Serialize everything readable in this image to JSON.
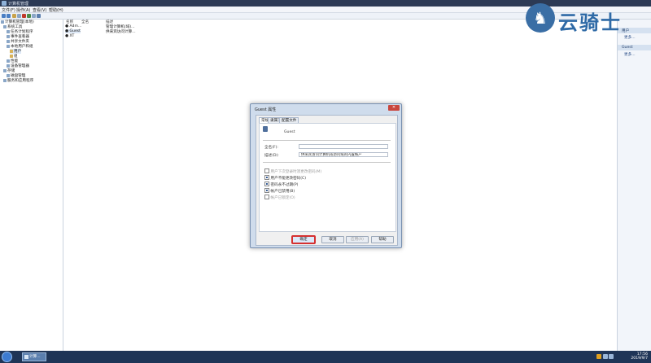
{
  "window": {
    "title": "计算机管理"
  },
  "menu": [
    "文件(F)",
    "操作(A)",
    "查看(V)",
    "帮助(H)"
  ],
  "tree": [
    {
      "label": "计算机管理(本地)",
      "level": 0
    },
    {
      "label": "系统工具",
      "level": 1
    },
    {
      "label": "任务计划程序",
      "level": 2
    },
    {
      "label": "事件查看器",
      "level": 2
    },
    {
      "label": "共享文件夹",
      "level": 2
    },
    {
      "label": "本地用户和组",
      "level": 2
    },
    {
      "label": "用户",
      "level": 3
    },
    {
      "label": "组",
      "level": 3
    },
    {
      "label": "性能",
      "level": 2
    },
    {
      "label": "设备管理器",
      "level": 2
    },
    {
      "label": "存储",
      "level": 1
    },
    {
      "label": "磁盘管理",
      "level": 2
    },
    {
      "label": "服务和应用程序",
      "level": 1
    }
  ],
  "list": {
    "columns": [
      "名称",
      "全名",
      "描述"
    ],
    "rows": [
      {
        "name": "Adm...",
        "fullname": "",
        "desc": "管理计算机(域)..."
      },
      {
        "name": "Guest",
        "fullname": "",
        "desc": "供来宾访问计算..."
      },
      {
        "name": "XT",
        "fullname": "",
        "desc": ""
      }
    ]
  },
  "actions": {
    "section1": "用户",
    "link1": "更多...",
    "section2": "Guest",
    "link2": "更多..."
  },
  "watermark": {
    "text": "云骑士"
  },
  "dialog": {
    "title": "Guest 属性",
    "tabs": [
      "常规",
      "隶属于",
      "配置文件"
    ],
    "username": "Guest",
    "fullname_label": "全名(F):",
    "fullname_value": "",
    "desc_label": "描述(D):",
    "desc_value": "供来宾访问计算机或访问域的内置帐户",
    "checkboxes": [
      {
        "label": "用户下次登录时须更改密码(M)",
        "checked": false,
        "disabled": true
      },
      {
        "label": "用户不能更改密码(C)",
        "checked": true,
        "disabled": false
      },
      {
        "label": "密码永不过期(P)",
        "checked": true,
        "disabled": false
      },
      {
        "label": "帐户已禁用(B)",
        "checked": true,
        "disabled": false
      },
      {
        "label": "帐户已锁定(O)",
        "checked": false,
        "disabled": true
      }
    ],
    "buttons": {
      "ok": "确定",
      "cancel": "取消",
      "apply": "应用(A)",
      "help": "帮助"
    }
  },
  "taskbar": {
    "app_label": "计算...",
    "time": "17:56",
    "date": "2019/9/7"
  }
}
